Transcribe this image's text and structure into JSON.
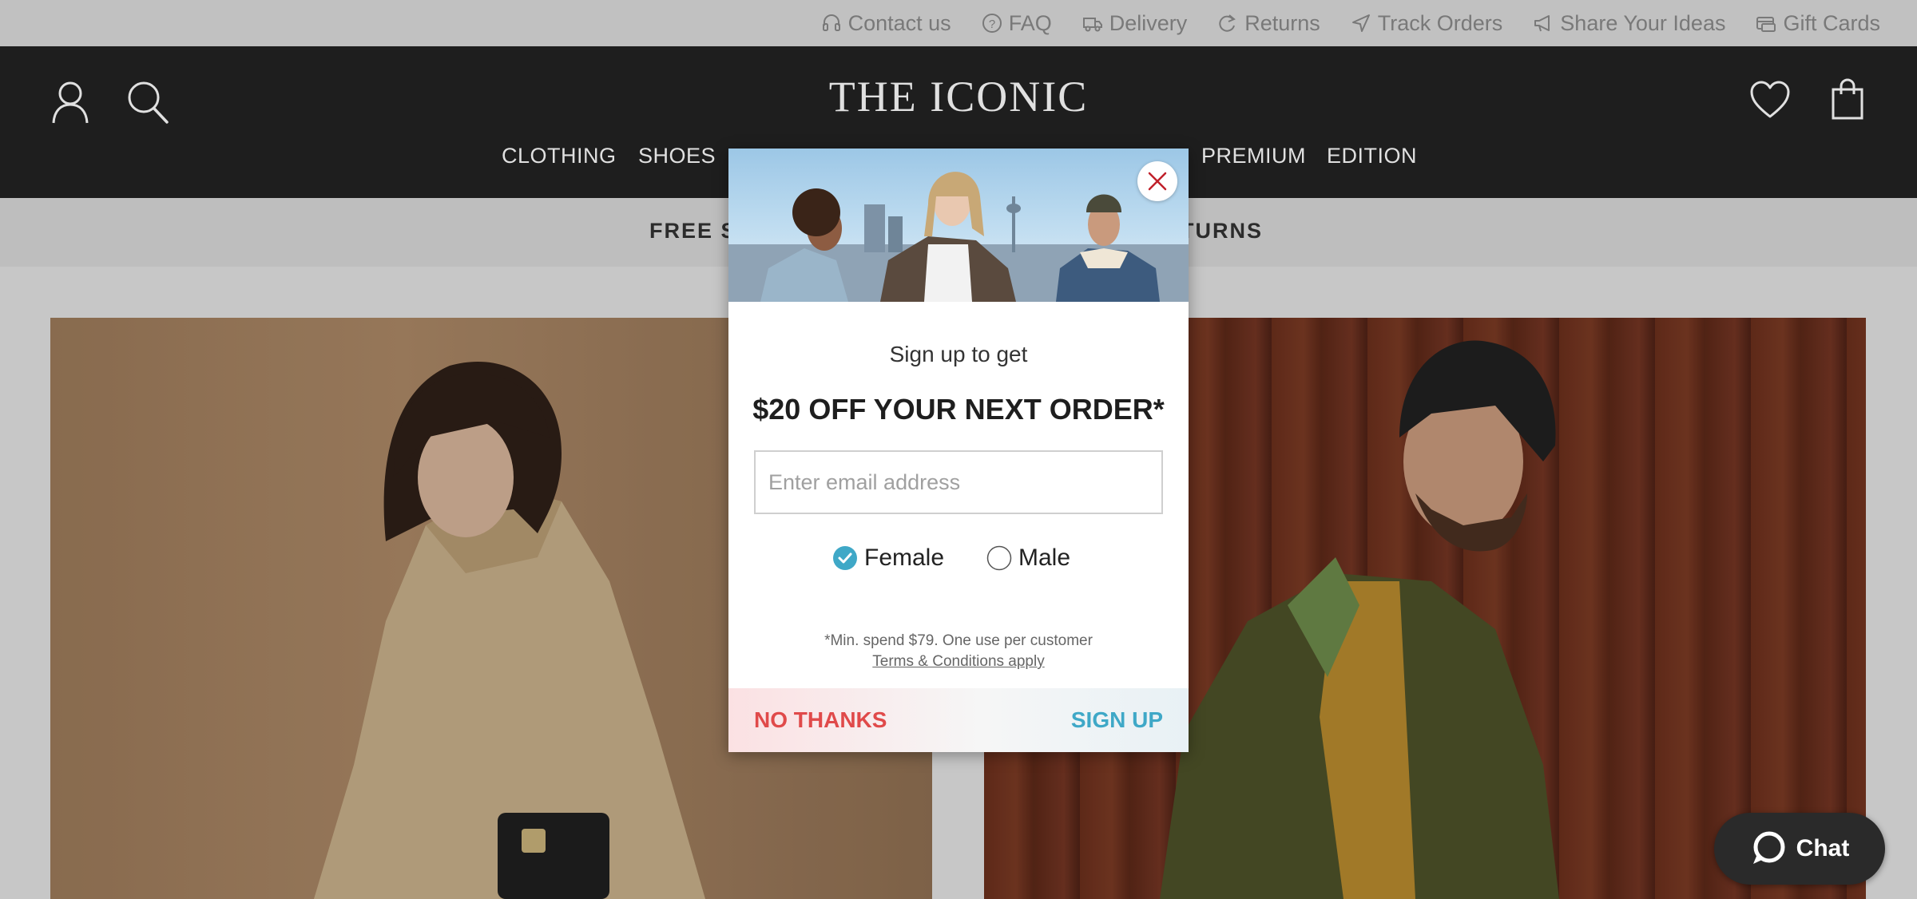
{
  "utility_links": [
    {
      "label": "Contact us",
      "icon": "headset-icon"
    },
    {
      "label": "FAQ",
      "icon": "question-icon"
    },
    {
      "label": "Delivery",
      "icon": "truck-icon"
    },
    {
      "label": "Returns",
      "icon": "returns-icon"
    },
    {
      "label": "Track Orders",
      "icon": "location-arrow-icon"
    },
    {
      "label": "Share Your Ideas",
      "icon": "megaphone-icon"
    },
    {
      "label": "Gift Cards",
      "icon": "gift-card-icon"
    }
  ],
  "header": {
    "logo": "THE ICONIC",
    "nav": [
      "CLOTHING",
      "SHOES",
      "PREMIUM",
      "EDITION"
    ]
  },
  "promo": {
    "left_text": "FREE S",
    "right_text": "TURNS"
  },
  "modal": {
    "subtitle": "Sign up to get",
    "headline": "$20 OFF YOUR NEXT ORDER*",
    "email_placeholder": "Enter email address",
    "gender_options": [
      "Female",
      "Male"
    ],
    "selected_gender": "Female",
    "disclaimer": "*Min. spend $79. One use per customer",
    "terms_link": "Terms & Conditions apply",
    "decline_label": "NO THANKS",
    "submit_label": "SIGN UP"
  },
  "chat": {
    "label": "Chat"
  },
  "colors": {
    "header_bg": "#232323",
    "decline": "#e04a4a",
    "accent": "#3fa8c7"
  }
}
